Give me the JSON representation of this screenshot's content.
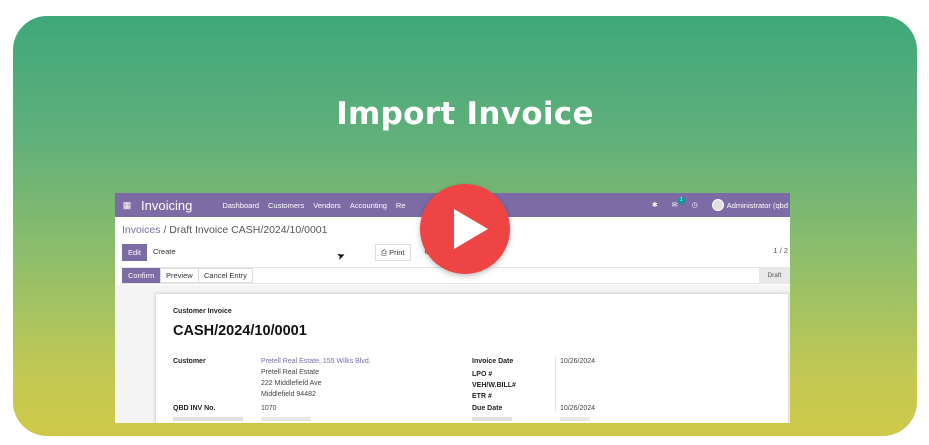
{
  "banner": {
    "title": "Import Invoice"
  },
  "app": {
    "brand": "Invoicing",
    "menu": [
      "Dashboard",
      "Customers",
      "Vendors",
      "Accounting",
      "Re"
    ],
    "chat_badge": "1",
    "user": "Administrator (qbd"
  },
  "breadcrumb": {
    "parent": "Invoices",
    "separator": " / ",
    "current": "Draft Invoice CASH/2024/10/0001"
  },
  "toolbar": {
    "edit": "Edit",
    "create": "Create",
    "print": "Print",
    "pager": "1 / 2"
  },
  "statusbar": {
    "confirm": "Confirm",
    "preview": "Preview",
    "cancel_entry": "Cancel Entry",
    "state": "Draft"
  },
  "invoice": {
    "type": "Customer Invoice",
    "number": "CASH/2024/10/0001",
    "customer_label": "Customer",
    "customer_name": "Pretell Real Estate, 155 Wilks Blvd.",
    "address_lines": [
      "Pretell Real Estate",
      "222 Middlefield Ave",
      "Middlefield 94482"
    ],
    "qbd_label": "QBD INV No.",
    "qbd_value": "1070",
    "invoice_date_label": "Invoice Date",
    "invoice_date": "10/26/2024",
    "lpo_label": "LPO #",
    "veh_label": "VEH/W.BILL#",
    "etr_label": "ETR #",
    "due_date_label": "Due Date",
    "due_date": "10/26/2024"
  },
  "icons": {
    "apps": "grid-icon",
    "bug": "bug-icon",
    "chat": "chat-icon",
    "clock": "clock-icon",
    "print": "printer-icon",
    "gear": "gear-icon",
    "play": "play-icon"
  },
  "colors": {
    "nav": "#7c6ba4",
    "play_button": "#ef4444",
    "gradient_top": "#3fa87a",
    "gradient_bottom": "#cfc84a"
  }
}
